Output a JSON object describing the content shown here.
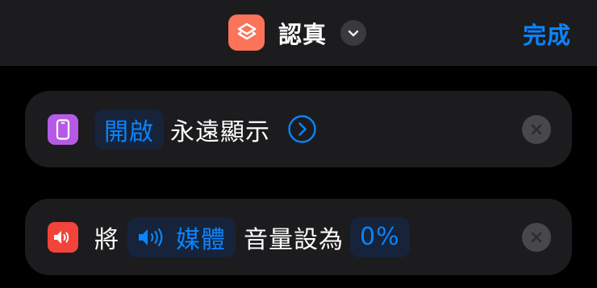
{
  "header": {
    "title": "認真",
    "app_icon": "shortcuts-icon",
    "done_label": "完成"
  },
  "actions": [
    {
      "icon": "iphone-icon",
      "icon_color": "#b65ae6",
      "verb": "開啟",
      "setting": "永遠顯示"
    },
    {
      "icon": "speaker-icon",
      "icon_color": "#f2443a",
      "prefix": "將",
      "target": "媒體",
      "middle": "音量設為",
      "value": "0%"
    }
  ],
  "colors": {
    "accent": "#0a84ff",
    "card": "#1c1c1e",
    "token_bg": "#16233a",
    "brand_icon": "#fb7358"
  }
}
